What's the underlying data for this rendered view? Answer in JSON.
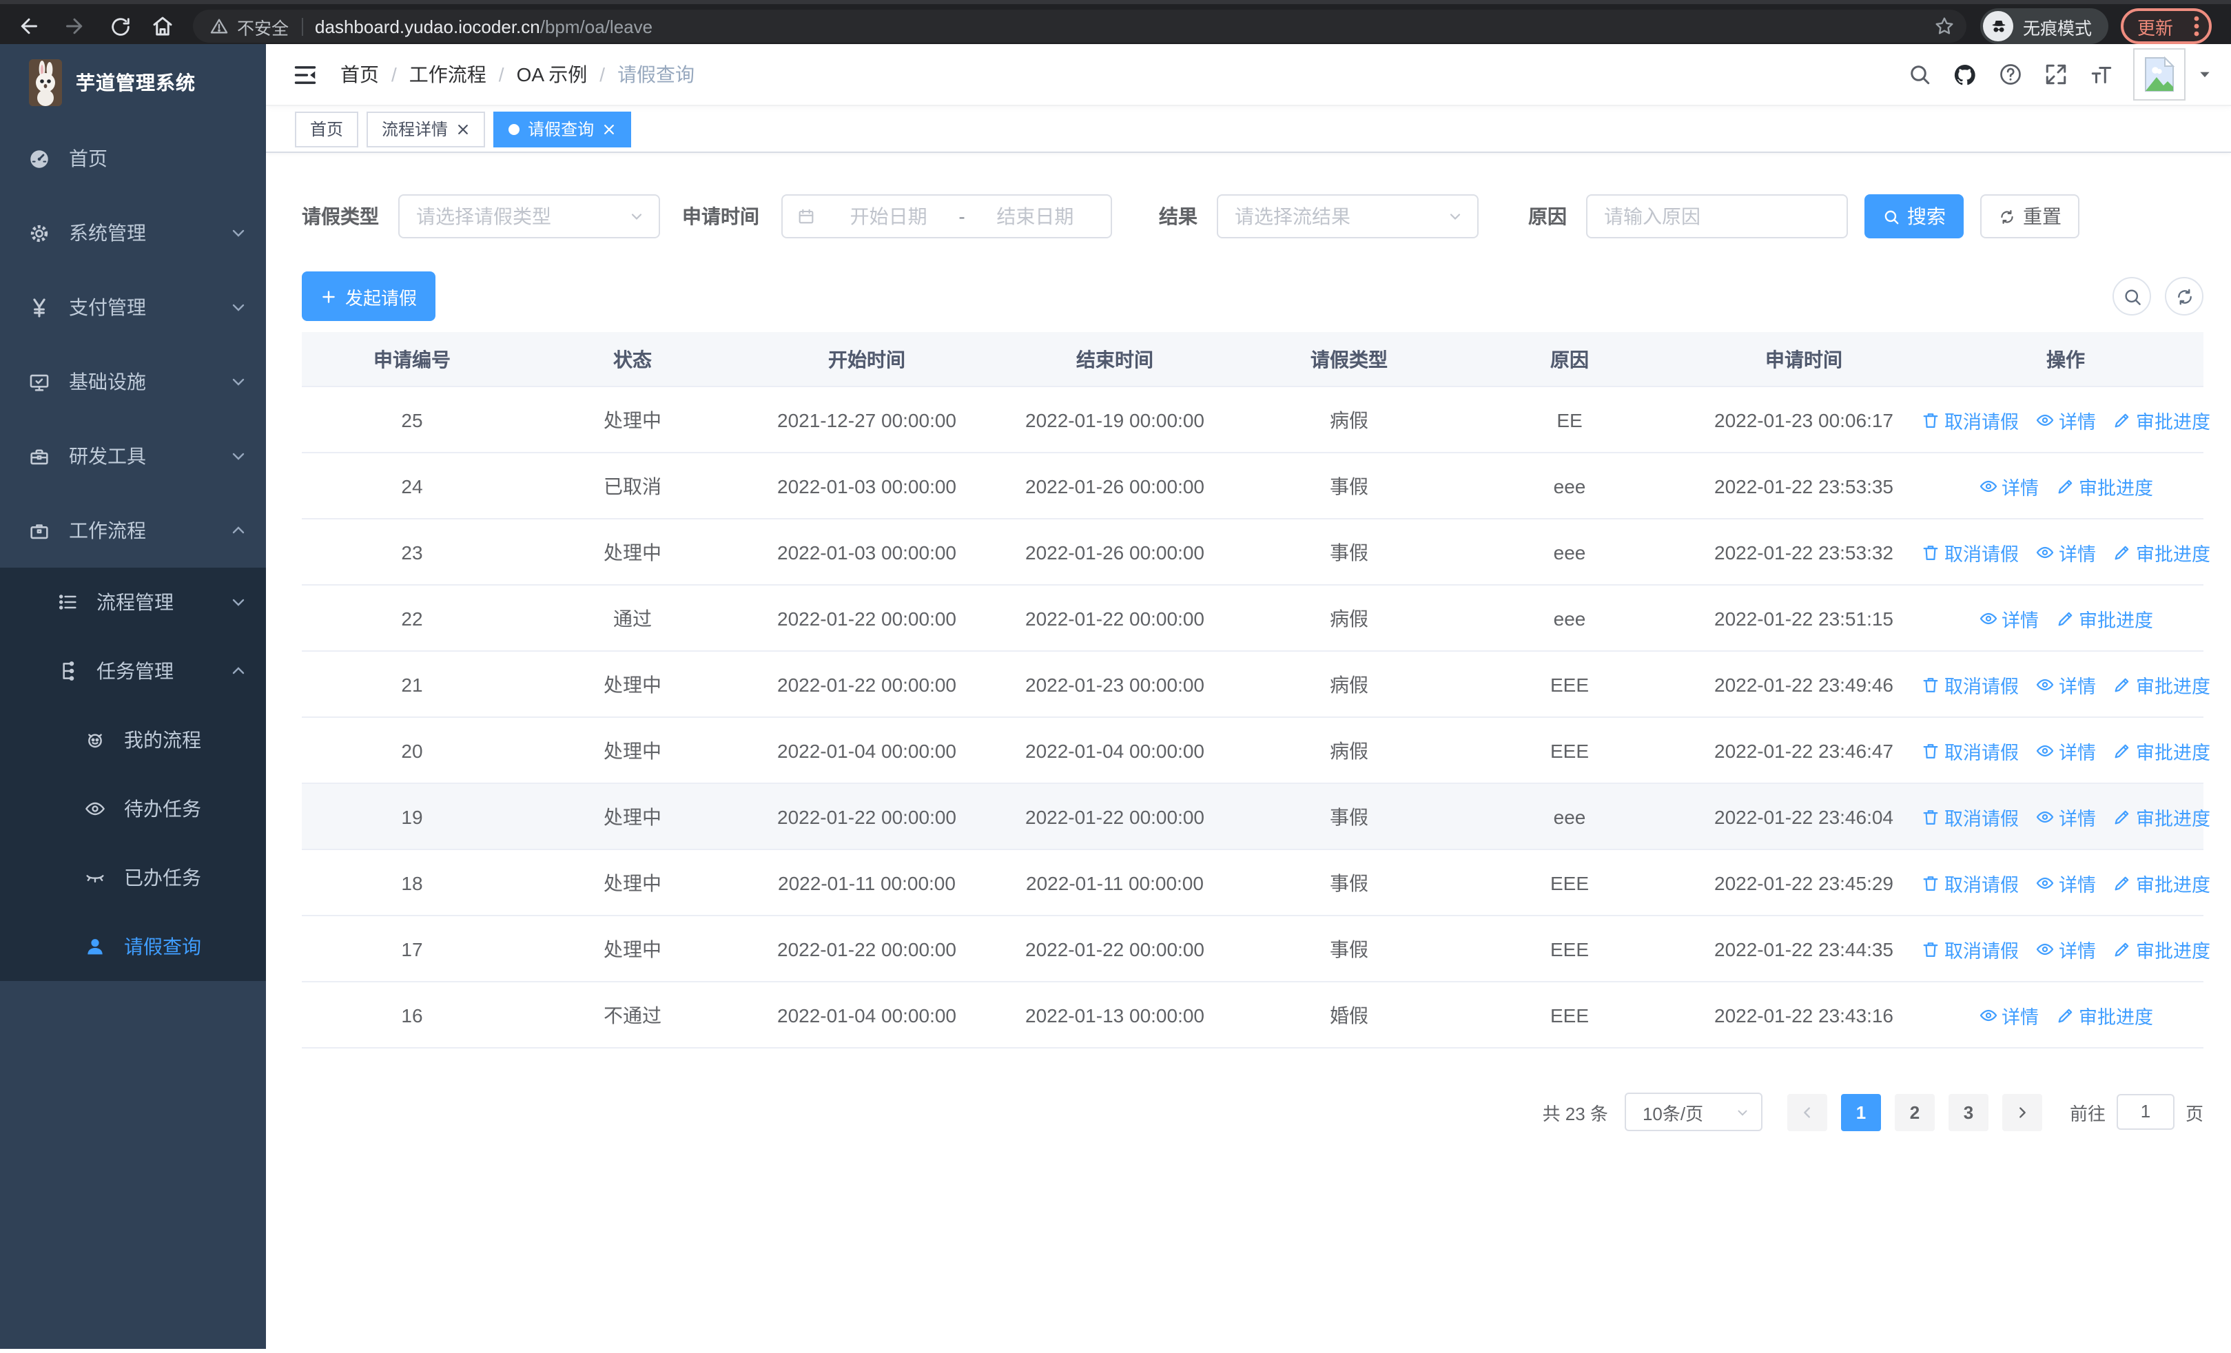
{
  "browser": {
    "security_label": "不安全",
    "url_host": "dashboard.yudao.iocoder.cn",
    "url_path": "/bpm/oa/leave",
    "incognito_label": "无痕模式",
    "update_label": "更新"
  },
  "sidebar": {
    "logo_title": "芋道管理系统",
    "items": [
      {
        "label": "首页",
        "expanded": null
      },
      {
        "label": "系统管理",
        "expanded": false
      },
      {
        "label": "支付管理",
        "expanded": false
      },
      {
        "label": "基础设施",
        "expanded": false
      },
      {
        "label": "研发工具",
        "expanded": false
      },
      {
        "label": "工作流程",
        "expanded": true
      }
    ],
    "submenu": [
      {
        "label": "流程管理",
        "expanded": false
      },
      {
        "label": "任务管理",
        "expanded": true
      }
    ],
    "task_items": [
      {
        "label": "我的流程",
        "active": false
      },
      {
        "label": "待办任务",
        "active": false
      },
      {
        "label": "已办任务",
        "active": false
      },
      {
        "label": "请假查询",
        "active": true
      }
    ]
  },
  "breadcrumb": {
    "separator": "/",
    "items": [
      "首页",
      "工作流程",
      "OA 示例",
      "请假查询"
    ]
  },
  "tabs": [
    {
      "label": "首页",
      "closable": false,
      "active": false
    },
    {
      "label": "流程详情",
      "closable": true,
      "active": false
    },
    {
      "label": "请假查询",
      "closable": true,
      "active": true
    }
  ],
  "filters": {
    "leave_type_label": "请假类型",
    "leave_type_placeholder": "请选择请假类型",
    "apply_time_label": "申请时间",
    "start_placeholder": "开始日期",
    "range_separator": "-",
    "end_placeholder": "结束日期",
    "result_label": "结果",
    "result_placeholder": "请选择流结果",
    "reason_label": "原因",
    "reason_placeholder": "请输入原因",
    "search_label": "搜索",
    "reset_label": "重置"
  },
  "actions_bar": {
    "create_label": "发起请假"
  },
  "table": {
    "columns": [
      {
        "key": "id",
        "label": "申请编号"
      },
      {
        "key": "status",
        "label": "状态"
      },
      {
        "key": "start_time",
        "label": "开始时间"
      },
      {
        "key": "end_time",
        "label": "结束时间"
      },
      {
        "key": "leave_type",
        "label": "请假类型"
      },
      {
        "key": "reason",
        "label": "原因"
      },
      {
        "key": "apply_time",
        "label": "申请时间"
      },
      {
        "key": "actions",
        "label": "操作"
      }
    ],
    "rows": [
      {
        "id": "25",
        "status": "处理中",
        "start_time": "2021-12-27 00:00:00",
        "end_time": "2022-01-19 00:00:00",
        "leave_type": "病假",
        "reason": "EE",
        "apply_time": "2022-01-23 00:06:17",
        "actions": [
          "取消请假",
          "详情",
          "审批进度"
        ],
        "highlighted": false
      },
      {
        "id": "24",
        "status": "已取消",
        "start_time": "2022-01-03 00:00:00",
        "end_time": "2022-01-26 00:00:00",
        "leave_type": "事假",
        "reason": "eee",
        "apply_time": "2022-01-22 23:53:35",
        "actions": [
          "详情",
          "审批进度"
        ],
        "highlighted": false
      },
      {
        "id": "23",
        "status": "处理中",
        "start_time": "2022-01-03 00:00:00",
        "end_time": "2022-01-26 00:00:00",
        "leave_type": "事假",
        "reason": "eee",
        "apply_time": "2022-01-22 23:53:32",
        "actions": [
          "取消请假",
          "详情",
          "审批进度"
        ],
        "highlighted": false
      },
      {
        "id": "22",
        "status": "通过",
        "start_time": "2022-01-22 00:00:00",
        "end_time": "2022-01-22 00:00:00",
        "leave_type": "病假",
        "reason": "eee",
        "apply_time": "2022-01-22 23:51:15",
        "actions": [
          "详情",
          "审批进度"
        ],
        "highlighted": false
      },
      {
        "id": "21",
        "status": "处理中",
        "start_time": "2022-01-22 00:00:00",
        "end_time": "2022-01-23 00:00:00",
        "leave_type": "病假",
        "reason": "EEE",
        "apply_time": "2022-01-22 23:49:46",
        "actions": [
          "取消请假",
          "详情",
          "审批进度"
        ],
        "highlighted": false
      },
      {
        "id": "20",
        "status": "处理中",
        "start_time": "2022-01-04 00:00:00",
        "end_time": "2022-01-04 00:00:00",
        "leave_type": "病假",
        "reason": "EEE",
        "apply_time": "2022-01-22 23:46:47",
        "actions": [
          "取消请假",
          "详情",
          "审批进度"
        ],
        "highlighted": false
      },
      {
        "id": "19",
        "status": "处理中",
        "start_time": "2022-01-22 00:00:00",
        "end_time": "2022-01-22 00:00:00",
        "leave_type": "事假",
        "reason": "eee",
        "apply_time": "2022-01-22 23:46:04",
        "actions": [
          "取消请假",
          "详情",
          "审批进度"
        ],
        "highlighted": true
      },
      {
        "id": "18",
        "status": "处理中",
        "start_time": "2022-01-11 00:00:00",
        "end_time": "2022-01-11 00:00:00",
        "leave_type": "事假",
        "reason": "EEE",
        "apply_time": "2022-01-22 23:45:29",
        "actions": [
          "取消请假",
          "详情",
          "审批进度"
        ],
        "highlighted": false
      },
      {
        "id": "17",
        "status": "处理中",
        "start_time": "2022-01-22 00:00:00",
        "end_time": "2022-01-22 00:00:00",
        "leave_type": "事假",
        "reason": "EEE",
        "apply_time": "2022-01-22 23:44:35",
        "actions": [
          "取消请假",
          "详情",
          "审批进度"
        ],
        "highlighted": false
      },
      {
        "id": "16",
        "status": "不通过",
        "start_time": "2022-01-04 00:00:00",
        "end_time": "2022-01-13 00:00:00",
        "leave_type": "婚假",
        "reason": "EEE",
        "apply_time": "2022-01-22 23:43:16",
        "actions": [
          "详情",
          "审批进度"
        ],
        "highlighted": false
      }
    ]
  },
  "pagination": {
    "total_label": "共 23 条",
    "page_size": "10条/页",
    "pages": [
      "1",
      "2",
      "3"
    ],
    "active_page": "1",
    "goto_label": "前往",
    "goto_value": "1",
    "unit_label": "页"
  },
  "colors": {
    "primary": "#409eff",
    "sidebar_bg": "#304156",
    "submenu_bg": "#1f2d3d",
    "chrome_bg": "#202124",
    "update_accent": "#f08b7b",
    "table_header_bg": "#f5f7fa"
  }
}
